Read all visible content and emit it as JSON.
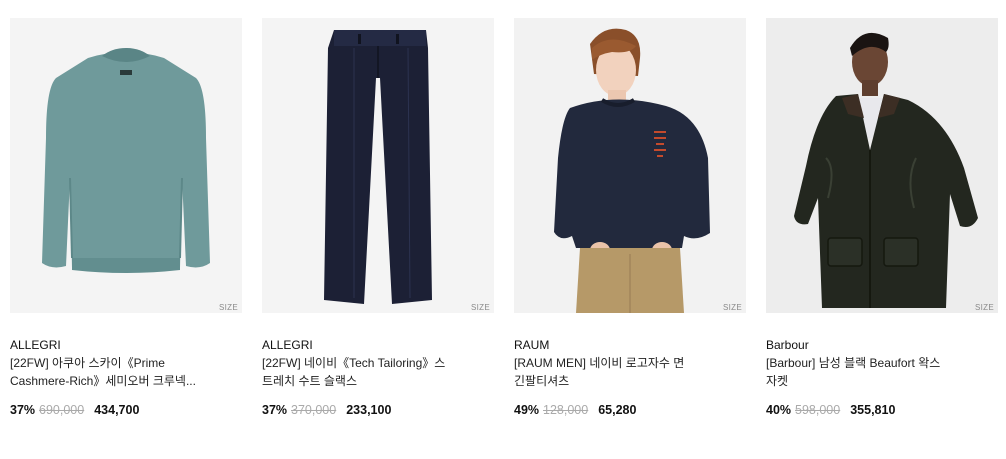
{
  "products": [
    {
      "brand": "ALLEGRI",
      "title_line1": "[22FW] 아쿠아 스카이《Prime",
      "title_line2": "Cashmere-Rich》세미오버 크루넥...",
      "discount": "37%",
      "original_price": "690,000",
      "final_price": "434,700",
      "size_label": "SIZE",
      "image": "aqua-sky-crewneck-sweater"
    },
    {
      "brand": "ALLEGRI",
      "title_line1": "[22FW] 네이비《Tech Tailoring》스",
      "title_line2": "트레치 수트 슬랙스",
      "discount": "37%",
      "original_price": "370,000",
      "final_price": "233,100",
      "size_label": "SIZE",
      "image": "navy-suit-slacks"
    },
    {
      "brand": "RAUM",
      "title_line1": "[RAUM MEN] 네이비 로고자수 면",
      "title_line2": "긴팔티셔츠",
      "discount": "49%",
      "original_price": "128,000",
      "final_price": "65,280",
      "size_label": "SIZE",
      "image": "model-navy-logo-sweatshirt"
    },
    {
      "brand": "Barbour",
      "title_line1": "[Barbour] 남성 블랙 Beaufort 왁스",
      "title_line2": "자켓",
      "discount": "40%",
      "original_price": "598,000",
      "final_price": "355,810",
      "size_label": "SIZE",
      "image": "model-black-wax-jacket"
    }
  ]
}
